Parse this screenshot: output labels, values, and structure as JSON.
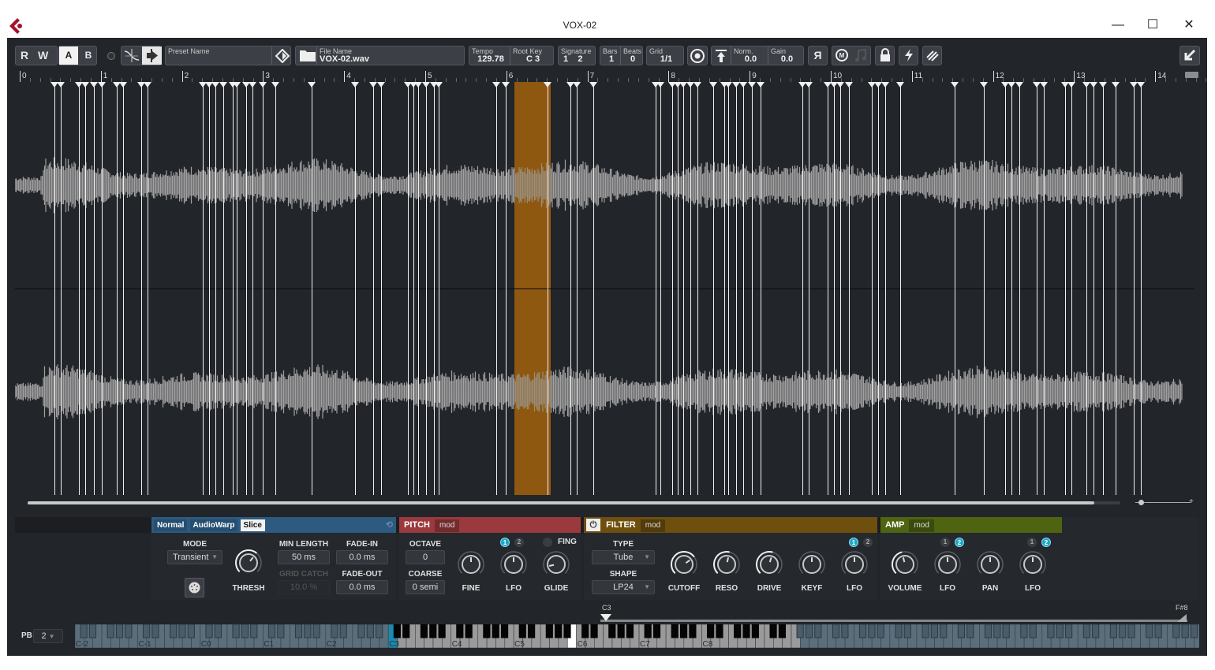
{
  "window": {
    "title": "VOX-02",
    "minimize_icon": "minimize-icon",
    "maximize_icon": "maximize-icon",
    "close_icon": "close-icon"
  },
  "toolbar": {
    "read_label": "R",
    "write_label": "W",
    "a_label": "A",
    "b_label": "B",
    "preset": {
      "label": "Preset Name",
      "value": ""
    },
    "file": {
      "label": "File Name",
      "value": "VOX-02.wav"
    },
    "tempo": {
      "label": "Tempo",
      "value": "129.78"
    },
    "root_key": {
      "label": "Root Key",
      "value": "C 3"
    },
    "signature": {
      "label": "Signature",
      "num": "1",
      "den": "2"
    },
    "bars": {
      "label": "Bars",
      "value": "1"
    },
    "beats": {
      "label": "Beats",
      "value": "0"
    },
    "grid": {
      "label": "Grid",
      "value": "1/1"
    },
    "norm": {
      "label": "Norm.",
      "value": "0.0"
    },
    "gain": {
      "label": "Gain",
      "value": "0.0"
    },
    "reverse_label": "Я"
  },
  "ruler": {
    "bars": [
      "0",
      "1",
      "2",
      "3",
      "4",
      "5",
      "6",
      "7",
      "8",
      "9",
      "10",
      "11",
      "12",
      "13",
      "14"
    ]
  },
  "waveform": {
    "selected_slice": {
      "start_bar": 6.05,
      "end_bar": 6.5
    },
    "slice_markers_px": [
      60,
      68,
      91,
      99,
      110,
      120,
      139,
      147,
      170,
      178,
      248,
      256,
      264,
      274,
      286,
      291,
      303,
      311,
      324,
      340,
      386,
      441,
      464,
      474,
      508,
      515,
      521,
      531,
      541,
      547,
      620,
      632,
      685,
      714,
      722,
      743,
      822,
      828,
      843,
      850,
      857,
      866,
      875,
      895,
      909,
      914,
      924,
      933,
      944,
      955,
      1008,
      1016,
      1040,
      1048,
      1056,
      1067,
      1096,
      1104,
      1113,
      1132,
      1201,
      1238,
      1265,
      1273,
      1283,
      1305,
      1314,
      1341,
      1349,
      1368,
      1377,
      1389,
      1405,
      1428,
      1437
    ]
  },
  "scroll": {
    "position": 0.98
  },
  "slice_panel": {
    "modes": [
      "Normal",
      "AudioWarp",
      "Slice"
    ],
    "active_mode": "Slice",
    "mode_label": "MODE",
    "mode_value": "Transient",
    "thresh_label": "THRESH",
    "min_length_label": "MIN LENGTH",
    "min_length_value": "50 ms",
    "grid_catch_label": "GRID CATCH",
    "grid_catch_value": "10.0 %",
    "fade_in_label": "FADE-IN",
    "fade_in_value": "0.0 ms",
    "fade_out_label": "FADE-OUT",
    "fade_out_value": "0.0 ms"
  },
  "pitch_panel": {
    "title": "PITCH",
    "mod": "mod",
    "color": "#9a3a3e",
    "octave_label": "OCTAVE",
    "octave_value": "0",
    "coarse_label": "COARSE",
    "coarse_value": "0 semi",
    "fine_label": "FINE",
    "lfo_label": "LFO",
    "glide_label": "GLIDE",
    "fing_label": "FING",
    "lfo1": "1",
    "lfo2": "2"
  },
  "filter_panel": {
    "title": "FILTER",
    "mod": "mod",
    "color": "#6e4f0e",
    "type_label": "TYPE",
    "type_value": "Tube",
    "shape_label": "SHAPE",
    "shape_value": "LP24",
    "knobs": [
      "CUTOFF",
      "RESO",
      "DRIVE",
      "KEYF",
      "LFO"
    ],
    "lfo1": "1",
    "lfo2": "2"
  },
  "amp_panel": {
    "title": "AMP",
    "mod": "mod",
    "color": "#4e6410",
    "knobs": [
      "VOLUME",
      "LFO",
      "PAN",
      "LFO"
    ],
    "lfo1": "1",
    "lfo2": "2"
  },
  "keyboard": {
    "pb_label": "PB",
    "pb_value": "2",
    "low_key_label": "C3",
    "high_key_label": "F#8",
    "octave_labels": [
      "C-2",
      "C-1",
      "C0",
      "C1",
      "C2",
      "C3",
      "C4",
      "C5",
      "C6",
      "C7",
      "C8"
    ]
  }
}
